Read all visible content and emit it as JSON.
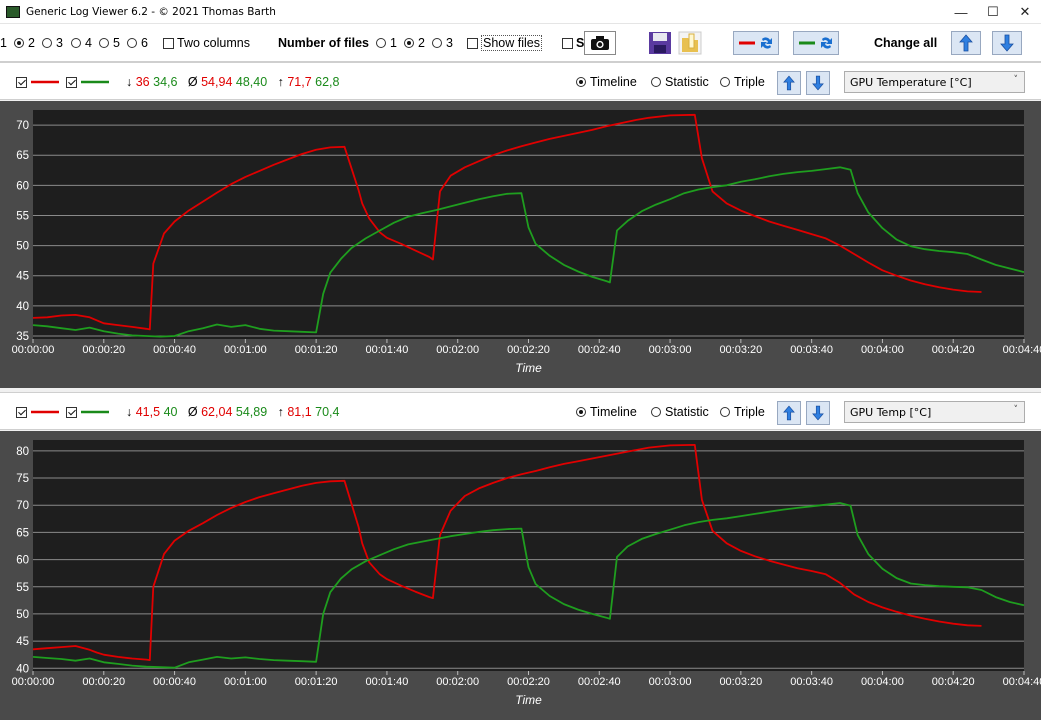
{
  "window": {
    "title": "Generic Log Viewer 6.2 - © 2021 Thomas Barth",
    "minimize": "—",
    "maximize": "☐",
    "close": "✕"
  },
  "toolbar": {
    "column_options": [
      "1",
      "2",
      "3",
      "4",
      "5",
      "6"
    ],
    "column_selected": "2",
    "two_columns_label": "Two columns",
    "number_of_files_label": "Number of files",
    "file_options": [
      "1",
      "2",
      "3"
    ],
    "file_selected": "2",
    "show_files_label": "Show files",
    "s_label": "S",
    "change_all_label": "Change all",
    "icons": [
      "camera-icon",
      "save-icon",
      "folder-icon",
      "red-swap-icon",
      "green-swap-icon",
      "arrow-up-icon",
      "arrow-down-icon"
    ]
  },
  "panels": [
    {
      "stats": {
        "min_red": "36",
        "min_green": "34,6",
        "avg_red": "54,94",
        "avg_green": "48,40",
        "max_red": "71,7",
        "max_green": "62,8"
      },
      "symbols": {
        "min": "↓",
        "avg": "Ø",
        "max": "↑"
      },
      "view_options": [
        "Timeline",
        "Statistic",
        "Triple"
      ],
      "view_selected": "Timeline",
      "sensor": "GPU Temperature [°C]"
    },
    {
      "stats": {
        "min_red": "41,5",
        "min_green": "40",
        "avg_red": "62,04",
        "avg_green": "54,89",
        "max_red": "81,1",
        "max_green": "70,4"
      },
      "symbols": {
        "min": "↓",
        "avg": "Ø",
        "max": "↑"
      },
      "view_options": [
        "Timeline",
        "Statistic",
        "Triple"
      ],
      "view_selected": "Timeline",
      "sensor": "GPU Temp [°C]"
    }
  ],
  "colors": {
    "red": "#e00000",
    "green": "#1a8a1a",
    "plot_bg": "#1e1e1e",
    "frame_bg": "#4a4a4a"
  },
  "chart_data": [
    {
      "type": "line",
      "xlabel": "Time",
      "ylabel": "",
      "ylim": [
        34.5,
        72.5
      ],
      "xlim": [
        0,
        280
      ],
      "yticks": [
        "35",
        "40",
        "45",
        "50",
        "55",
        "60",
        "65",
        "70"
      ],
      "ytick_values": [
        35,
        40,
        45,
        50,
        55,
        60,
        65,
        70
      ],
      "xticks": [
        "00:00:00",
        "00:00:20",
        "00:00:40",
        "00:01:00",
        "00:01:20",
        "00:01:40",
        "00:02:00",
        "00:02:20",
        "00:02:40",
        "00:03:00",
        "00:03:20",
        "00:03:40",
        "00:04:00",
        "00:04:20",
        "00:04:40"
      ],
      "grid": true,
      "series": [
        {
          "color": "red",
          "x": [
            0,
            4,
            8,
            12,
            16,
            18,
            20,
            24,
            28,
            32,
            33,
            34,
            37,
            40,
            44,
            48,
            52,
            56,
            60,
            64,
            68,
            72,
            76,
            80,
            84,
            88,
            92,
            93,
            95,
            98,
            100,
            104,
            108,
            112,
            113,
            115,
            118,
            122,
            126,
            130,
            134,
            138,
            142,
            146,
            150,
            154,
            158,
            162,
            166,
            170,
            174,
            180,
            187,
            189,
            192,
            196,
            200,
            204,
            208,
            212,
            216,
            220,
            224,
            228,
            232,
            236,
            240,
            244,
            248,
            252,
            256,
            260,
            264,
            268
          ],
          "y": [
            38,
            38.1,
            38.4,
            38.5,
            38.1,
            37.6,
            37.1,
            36.8,
            36.5,
            36.2,
            36.1,
            47,
            52,
            54,
            55.8,
            57.3,
            58.8,
            60.2,
            61.4,
            62.4,
            63.4,
            64.3,
            65.2,
            65.9,
            66.3,
            66.4,
            59.2,
            57,
            54.5,
            52.2,
            51.3,
            50.3,
            49.2,
            48.1,
            47.7,
            59,
            61.6,
            63,
            64,
            65,
            65.8,
            66.5,
            67.1,
            67.7,
            68.2,
            68.7,
            69.2,
            69.8,
            70.3,
            70.8,
            71.2,
            71.6,
            71.7,
            64.5,
            59,
            57,
            55.8,
            54.9,
            54,
            53.3,
            52.6,
            51.9,
            51.2,
            50,
            48.6,
            47.2,
            45.9,
            45,
            44.2,
            43.6,
            43.1,
            42.7,
            42.4,
            42.3
          ]
        },
        {
          "color": "green",
          "x": [
            0,
            4,
            8,
            12,
            16,
            20,
            24,
            28,
            32,
            36,
            40,
            44,
            48,
            52,
            56,
            60,
            64,
            68,
            72,
            76,
            80,
            82,
            84,
            87,
            90,
            94,
            98,
            102,
            106,
            110,
            114,
            118,
            122,
            126,
            130,
            134,
            138,
            140,
            142,
            146,
            150,
            154,
            158,
            162,
            163,
            165,
            168,
            172,
            176,
            180,
            184,
            188,
            192,
            196,
            200,
            204,
            208,
            212,
            216,
            220,
            224,
            228,
            231,
            233,
            236,
            240,
            244,
            248,
            252,
            256,
            260,
            264,
            268,
            272,
            276,
            280
          ],
          "y": [
            36.8,
            36.6,
            36.3,
            36.0,
            36.4,
            35.8,
            35.4,
            35.1,
            35.0,
            34.9,
            35.0,
            35.8,
            36.3,
            36.9,
            36.5,
            36.8,
            36.2,
            35.9,
            35.8,
            35.7,
            35.6,
            42,
            45.5,
            47.8,
            49.6,
            51.2,
            52.5,
            53.8,
            54.8,
            55.4,
            55.9,
            56.5,
            57.1,
            57.7,
            58.2,
            58.6,
            58.7,
            53,
            50.3,
            48.3,
            46.8,
            45.7,
            44.8,
            44.1,
            43.9,
            52.5,
            54.1,
            55.7,
            56.8,
            57.7,
            58.7,
            59.3,
            59.7,
            60.0,
            60.6,
            61.0,
            61.5,
            61.9,
            62.2,
            62.4,
            62.7,
            63.0,
            62.6,
            58.7,
            55.5,
            52.9,
            51.0,
            49.9,
            49.4,
            49.1,
            48.9,
            48.6,
            47.7,
            46.8,
            46.2,
            45.6
          ]
        }
      ]
    },
    {
      "type": "line",
      "xlabel": "Time",
      "ylabel": "",
      "ylim": [
        39.5,
        82
      ],
      "xlim": [
        0,
        280
      ],
      "yticks": [
        "40",
        "45",
        "50",
        "55",
        "60",
        "65",
        "70",
        "75",
        "80"
      ],
      "ytick_values": [
        40,
        45,
        50,
        55,
        60,
        65,
        70,
        75,
        80
      ],
      "xticks": [
        "00:00:00",
        "00:00:20",
        "00:00:40",
        "00:01:00",
        "00:01:20",
        "00:01:40",
        "00:02:00",
        "00:02:20",
        "00:02:40",
        "00:03:00",
        "00:03:20",
        "00:03:40",
        "00:04:00",
        "00:04:20",
        "00:04:40"
      ],
      "grid": true,
      "series": [
        {
          "color": "red",
          "x": [
            0,
            4,
            8,
            12,
            16,
            18,
            20,
            24,
            28,
            32,
            33,
            34,
            37,
            40,
            44,
            48,
            52,
            56,
            60,
            64,
            68,
            72,
            76,
            80,
            84,
            88,
            92,
            93,
            95,
            98,
            100,
            104,
            108,
            112,
            113,
            115,
            118,
            122,
            126,
            130,
            134,
            138,
            142,
            146,
            150,
            154,
            158,
            162,
            166,
            170,
            174,
            180,
            187,
            189,
            192,
            196,
            200,
            204,
            208,
            212,
            216,
            220,
            224,
            228,
            232,
            236,
            240,
            244,
            248,
            252,
            256,
            260,
            264,
            268
          ],
          "y": [
            43.5,
            43.7,
            43.9,
            44.1,
            43.4,
            42.9,
            42.5,
            42.1,
            41.8,
            41.6,
            41.5,
            55,
            61,
            63.5,
            65.3,
            66.7,
            68.2,
            69.5,
            70.6,
            71.5,
            72.2,
            72.9,
            73.6,
            74.1,
            74.4,
            74.5,
            66,
            63,
            59.5,
            57.3,
            56.4,
            55.2,
            54.1,
            53.1,
            52.9,
            64.5,
            69,
            71.7,
            73.1,
            74.1,
            75,
            75.7,
            76.3,
            77,
            77.6,
            78.1,
            78.6,
            79.1,
            79.6,
            80.1,
            80.6,
            81,
            81.1,
            71,
            65.3,
            63,
            61.6,
            60.6,
            59.8,
            59.1,
            58.4,
            57.9,
            57.3,
            55.7,
            53.6,
            52.2,
            51.2,
            50.4,
            49.7,
            49.1,
            48.6,
            48.2,
            47.9,
            47.8
          ]
        },
        {
          "color": "green",
          "x": [
            0,
            4,
            8,
            12,
            16,
            20,
            24,
            28,
            32,
            36,
            40,
            44,
            48,
            52,
            56,
            60,
            64,
            68,
            72,
            76,
            80,
            82,
            84,
            87,
            90,
            94,
            98,
            102,
            106,
            110,
            114,
            118,
            122,
            126,
            130,
            134,
            138,
            140,
            142,
            146,
            150,
            154,
            158,
            162,
            163,
            165,
            168,
            172,
            176,
            180,
            184,
            188,
            192,
            196,
            200,
            204,
            208,
            212,
            216,
            220,
            224,
            228,
            231,
            233,
            236,
            240,
            244,
            248,
            252,
            256,
            260,
            264,
            268,
            272,
            276,
            280
          ],
          "y": [
            42.1,
            41.9,
            41.7,
            41.4,
            41.8,
            41.1,
            40.8,
            40.5,
            40.3,
            40.2,
            40.1,
            41.1,
            41.6,
            42.1,
            41.8,
            42.0,
            41.7,
            41.5,
            41.4,
            41.3,
            41.2,
            50,
            54,
            56.5,
            58.2,
            59.7,
            60.8,
            61.9,
            62.8,
            63.3,
            63.8,
            64.3,
            64.7,
            65.1,
            65.4,
            65.6,
            65.7,
            58.6,
            55.5,
            53.3,
            51.8,
            50.8,
            50,
            49.3,
            49.1,
            60.5,
            62.4,
            63.8,
            64.7,
            65.5,
            66.3,
            66.9,
            67.3,
            67.6,
            68.0,
            68.4,
            68.8,
            69.2,
            69.5,
            69.8,
            70.1,
            70.4,
            69.9,
            64.5,
            61.0,
            58.3,
            56.6,
            55.6,
            55.3,
            55.1,
            55.0,
            54.9,
            54.4,
            53.1,
            52.2,
            51.6
          ]
        }
      ]
    }
  ]
}
